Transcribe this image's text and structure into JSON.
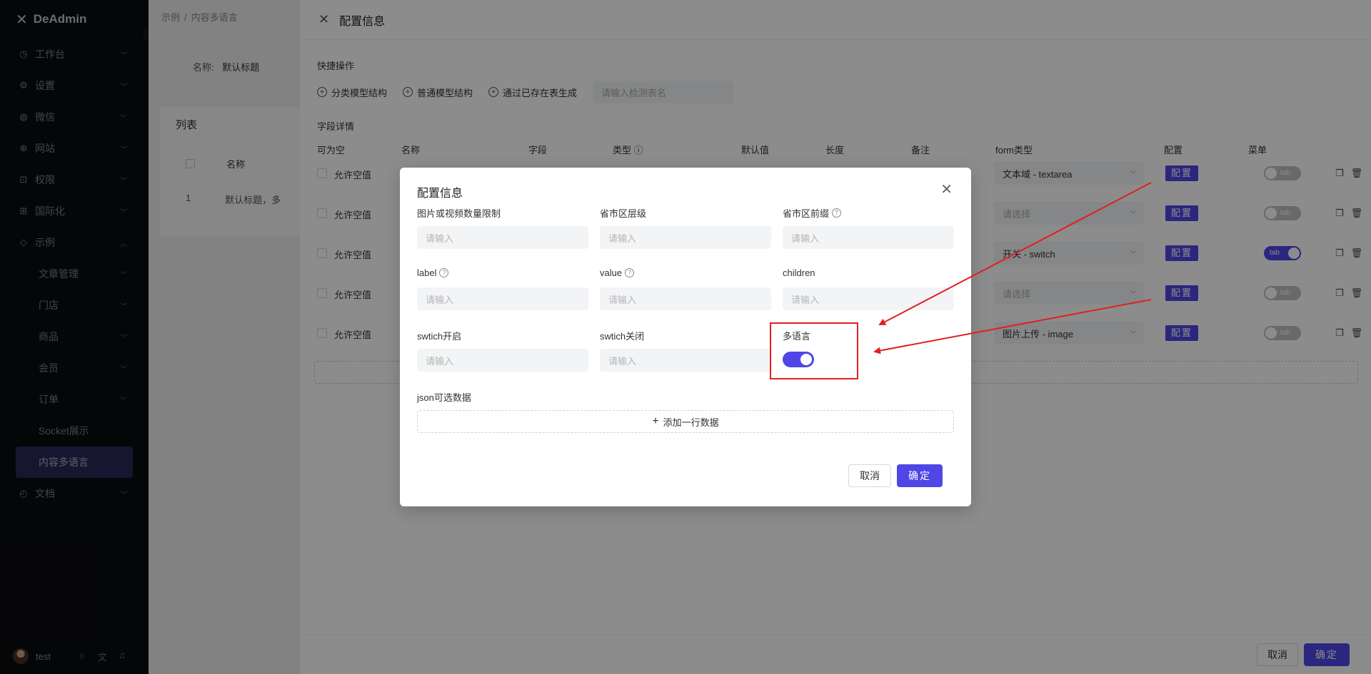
{
  "app": {
    "brand": "DeAdmin"
  },
  "sidebar": {
    "items": [
      {
        "label": "工作台",
        "icon": "dashboard-icon",
        "chevron": "down"
      },
      {
        "label": "设置",
        "icon": "gear-icon",
        "chevron": "down"
      },
      {
        "label": "微信",
        "icon": "wechat-icon",
        "chevron": "down"
      },
      {
        "label": "网站",
        "icon": "globe-icon",
        "chevron": "down"
      },
      {
        "label": "权限",
        "icon": "lock-icon",
        "chevron": "down"
      },
      {
        "label": "国际化",
        "icon": "translate-icon",
        "chevron": "down"
      },
      {
        "label": "示例",
        "icon": "tag-icon",
        "chevron": "up"
      }
    ],
    "sub_items": [
      {
        "label": "文章管理"
      },
      {
        "label": "门店"
      },
      {
        "label": "商品"
      },
      {
        "label": "会员"
      },
      {
        "label": "订单"
      },
      {
        "label": "Socket展示"
      },
      {
        "label": "内容多语言"
      }
    ],
    "docs": {
      "label": "文档",
      "icon": "clock-icon"
    },
    "user": {
      "name": "test"
    }
  },
  "main": {
    "breadcrumb": [
      "示例",
      "内容多语言"
    ],
    "filter_label": "名称:",
    "filter_value": "默认标题",
    "list_title": "列表",
    "col_name": "名称",
    "row_index": "1",
    "row_name": "默认标题，多"
  },
  "drawer": {
    "title": "配置信息",
    "quick_label": "快捷操作",
    "quick_ops": [
      "分类模型结构",
      "普通模型结构",
      "通过已存在表生成"
    ],
    "quick_placeholder": "请输入检测表名",
    "fields_label": "字段详情",
    "columns": [
      "可为空",
      "名称",
      "字段",
      "类型",
      "默认值",
      "长度",
      "备注",
      "form类型",
      "配置",
      "菜单"
    ],
    "rows": [
      {
        "allow": "允许空值",
        "form_type": "文本域 - textarea",
        "config": "配置",
        "tab": "tab"
      },
      {
        "allow": "允许空值",
        "form_type": "请选择",
        "config": "配置",
        "tab": "tab"
      },
      {
        "allow": "允许空值",
        "form_type": "开关 - switch",
        "config": "配置",
        "tab": "tab"
      },
      {
        "allow": "允许空值",
        "form_type": "请选择",
        "config": "配置",
        "tab": "tab"
      },
      {
        "allow": "允许空值",
        "form_type": "图片上传 - image",
        "config": "配置",
        "tab": "tab"
      }
    ],
    "cancel": "取消",
    "confirm": "确定"
  },
  "modal": {
    "title": "配置信息",
    "fields": [
      {
        "label": "图片或视频数量限制",
        "placeholder": "请输入"
      },
      {
        "label": "省市区层级",
        "placeholder": "请输入"
      },
      {
        "label": "省市区前缀",
        "placeholder": "请输入"
      },
      {
        "label": "label",
        "placeholder": "请输入"
      },
      {
        "label": "value",
        "placeholder": "请输入"
      },
      {
        "label": "children",
        "placeholder": "请输入"
      },
      {
        "label": "swtich开启",
        "placeholder": "请输入"
      },
      {
        "label": "swtich关闭",
        "placeholder": "请输入"
      }
    ],
    "multilang_label": "多语言",
    "multilang_on": true,
    "json_label": "json可选数据",
    "add_row": "添加一行数据",
    "cancel": "取消",
    "confirm": "确定"
  },
  "colors": {
    "primary": "#4f46e5",
    "annotation": "#e02020",
    "sidebar_bg": "#0b0c10"
  }
}
